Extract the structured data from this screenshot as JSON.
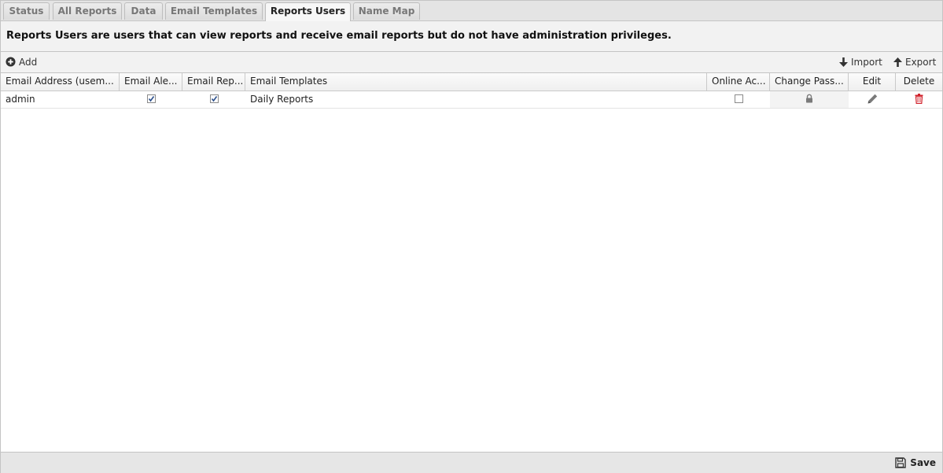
{
  "tabs": [
    {
      "label": "Status",
      "active": false
    },
    {
      "label": "All Reports",
      "active": false
    },
    {
      "label": "Data",
      "active": false
    },
    {
      "label": "Email Templates",
      "active": false
    },
    {
      "label": "Reports Users",
      "active": true
    },
    {
      "label": "Name Map",
      "active": false
    }
  ],
  "description": "Reports Users are users that can view reports and receive email reports but do not have administration privileges.",
  "toolbar": {
    "add_label": "Add",
    "import_label": "Import",
    "export_label": "Export"
  },
  "columns": [
    "Email Address (usem...",
    "Email Ale...",
    "Email Rep...",
    "Email Templates",
    "Online Ac...",
    "Change Pass...",
    "Edit",
    "Delete"
  ],
  "rows": [
    {
      "email": "admin",
      "email_alerts": true,
      "email_reports": true,
      "email_templates": "Daily Reports",
      "online_access": false
    }
  ],
  "footer": {
    "save_label": "Save"
  },
  "colors": {
    "delete_icon": "#d0202a",
    "icon_gray": "#7a7a7a",
    "text": "#222222"
  }
}
